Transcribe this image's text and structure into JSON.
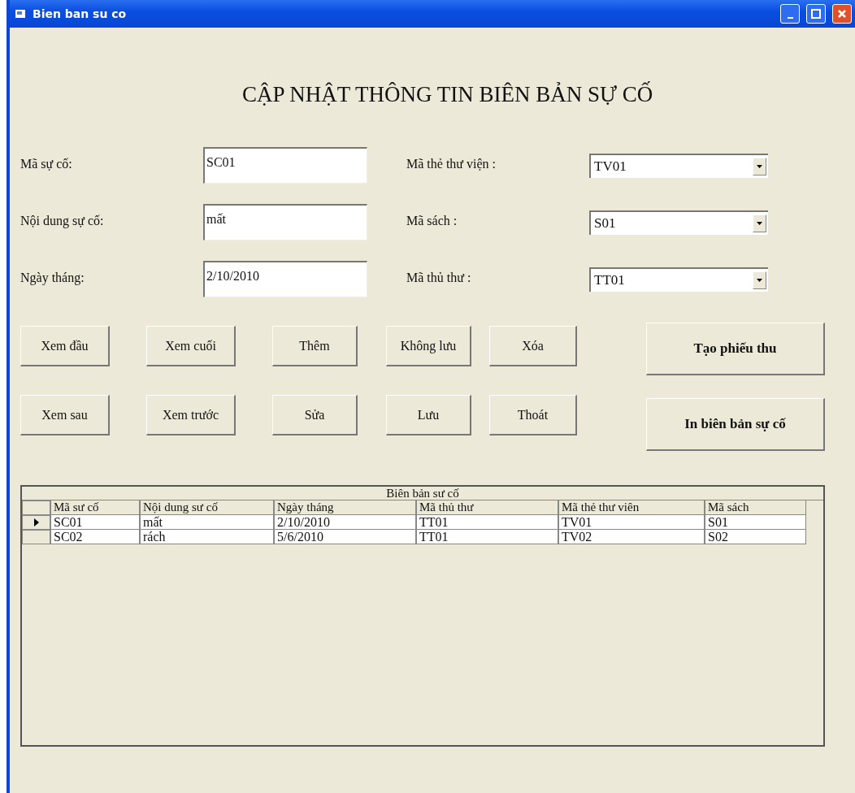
{
  "window": {
    "title": "Bien ban su co"
  },
  "heading": "CẬP NHẬT THÔNG TIN BIÊN BẢN SỰ CỐ",
  "fields": [
    {
      "label": "Mã sự cố:",
      "value": "SC01"
    },
    {
      "label": "Nội dung sự cố:",
      "value": "mất"
    },
    {
      "label": "Ngày tháng:",
      "value": "2/10/2010"
    }
  ],
  "combos": [
    {
      "label": "Mã thẻ thư viện :",
      "value": "TV01"
    },
    {
      "label": "Mã sách :",
      "value": "S01"
    },
    {
      "label": "Mã thủ thư :",
      "value": "TT01"
    }
  ],
  "button_rows": [
    [
      "Xem đầu",
      "Xem cuối",
      "Thêm",
      "Không lưu",
      "Xóa"
    ],
    [
      "Xem sau",
      "Xem trước",
      "Sửa",
      "Lưu",
      "Thoát"
    ]
  ],
  "big_buttons": [
    "Tạo phiếu thu",
    "In biên bản sự cố"
  ],
  "table": {
    "caption": "Biên bản sư cố",
    "columns": [
      "Mã sư cố",
      "Nội dung sư cố",
      "Ngày tháng",
      "Mã thủ thư",
      "Mã thẻ thư viên",
      "Mã sách"
    ],
    "rows": [
      {
        "selected": true,
        "cells": [
          "SC01",
          "mất",
          "2/10/2010",
          "TT01",
          "TV01",
          "S01"
        ]
      },
      {
        "selected": false,
        "cells": [
          "SC02",
          "rách",
          "5/6/2010",
          "TT01",
          "TV02",
          "S02"
        ]
      }
    ]
  }
}
